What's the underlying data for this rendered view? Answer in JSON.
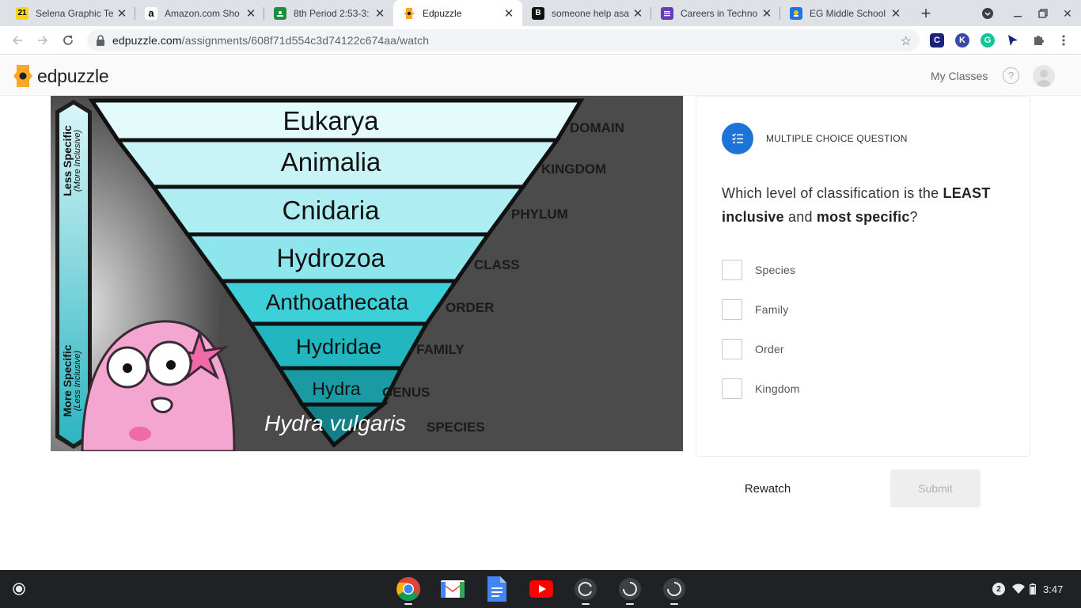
{
  "browser": {
    "tabs": [
      {
        "title": "Selena Graphic Te",
        "favicon": "21",
        "favicon_color": "#f7d416",
        "favicon_text_color": "#000000"
      },
      {
        "title": "Amazon.com Sho",
        "favicon": "a",
        "favicon_color": "#ffffff",
        "favicon_text_color": "#000000"
      },
      {
        "title": "8th Period 2:53-3:",
        "favicon": "classroom-icon",
        "favicon_color": "#1e8e3e"
      },
      {
        "title": "Edpuzzle",
        "favicon": "edpuzzle-icon",
        "favicon_color": "#f9a825",
        "active": true
      },
      {
        "title": "someone help asa",
        "favicon": "B",
        "favicon_color": "#111111",
        "favicon_text_color": "#ffffff"
      },
      {
        "title": "Careers in Techno",
        "favicon": "forms-icon",
        "favicon_color": "#673ab7"
      },
      {
        "title": "EG Middle School",
        "favicon": "school-icon",
        "favicon_color": "#1a73e8"
      }
    ],
    "url_host": "edpuzzle.com",
    "url_path": "/assignments/608f71d554c3d74122c674aa/watch"
  },
  "header": {
    "logo_text": "edpuzzle",
    "my_classes": "My Classes",
    "help": "?"
  },
  "video": {
    "side_top": "Less Specific",
    "side_top_sub": "(More Inclusive)",
    "side_bottom": "More Specific",
    "side_bottom_sub": "(Less Inclusive)",
    "levels": [
      {
        "name": "Eukarya",
        "rank": "DOMAIN"
      },
      {
        "name": "Animalia",
        "rank": "KINGDOM"
      },
      {
        "name": "Cnidaria",
        "rank": "PHYLUM"
      },
      {
        "name": "Hydrozoa",
        "rank": "CLASS"
      },
      {
        "name": "Anthoathecata",
        "rank": "ORDER"
      },
      {
        "name": "Hydridae",
        "rank": "FAMILY"
      },
      {
        "name": "Hydra",
        "rank": "GENUS"
      },
      {
        "name": "Hydra vulgaris",
        "rank": "SPECIES"
      }
    ]
  },
  "question": {
    "type_label": "MULTIPLE CHOICE QUESTION",
    "text_a": "Which level of classification is the ",
    "text_b": "LEAST inclusive",
    "text_c": " and ",
    "text_d": "most specific",
    "text_e": "?",
    "options": [
      "Species",
      "Family",
      "Order",
      "Kingdom"
    ]
  },
  "actions": {
    "rewatch": "Rewatch",
    "submit": "Submit"
  },
  "shelf": {
    "notifications": "2",
    "time": "3:47"
  }
}
